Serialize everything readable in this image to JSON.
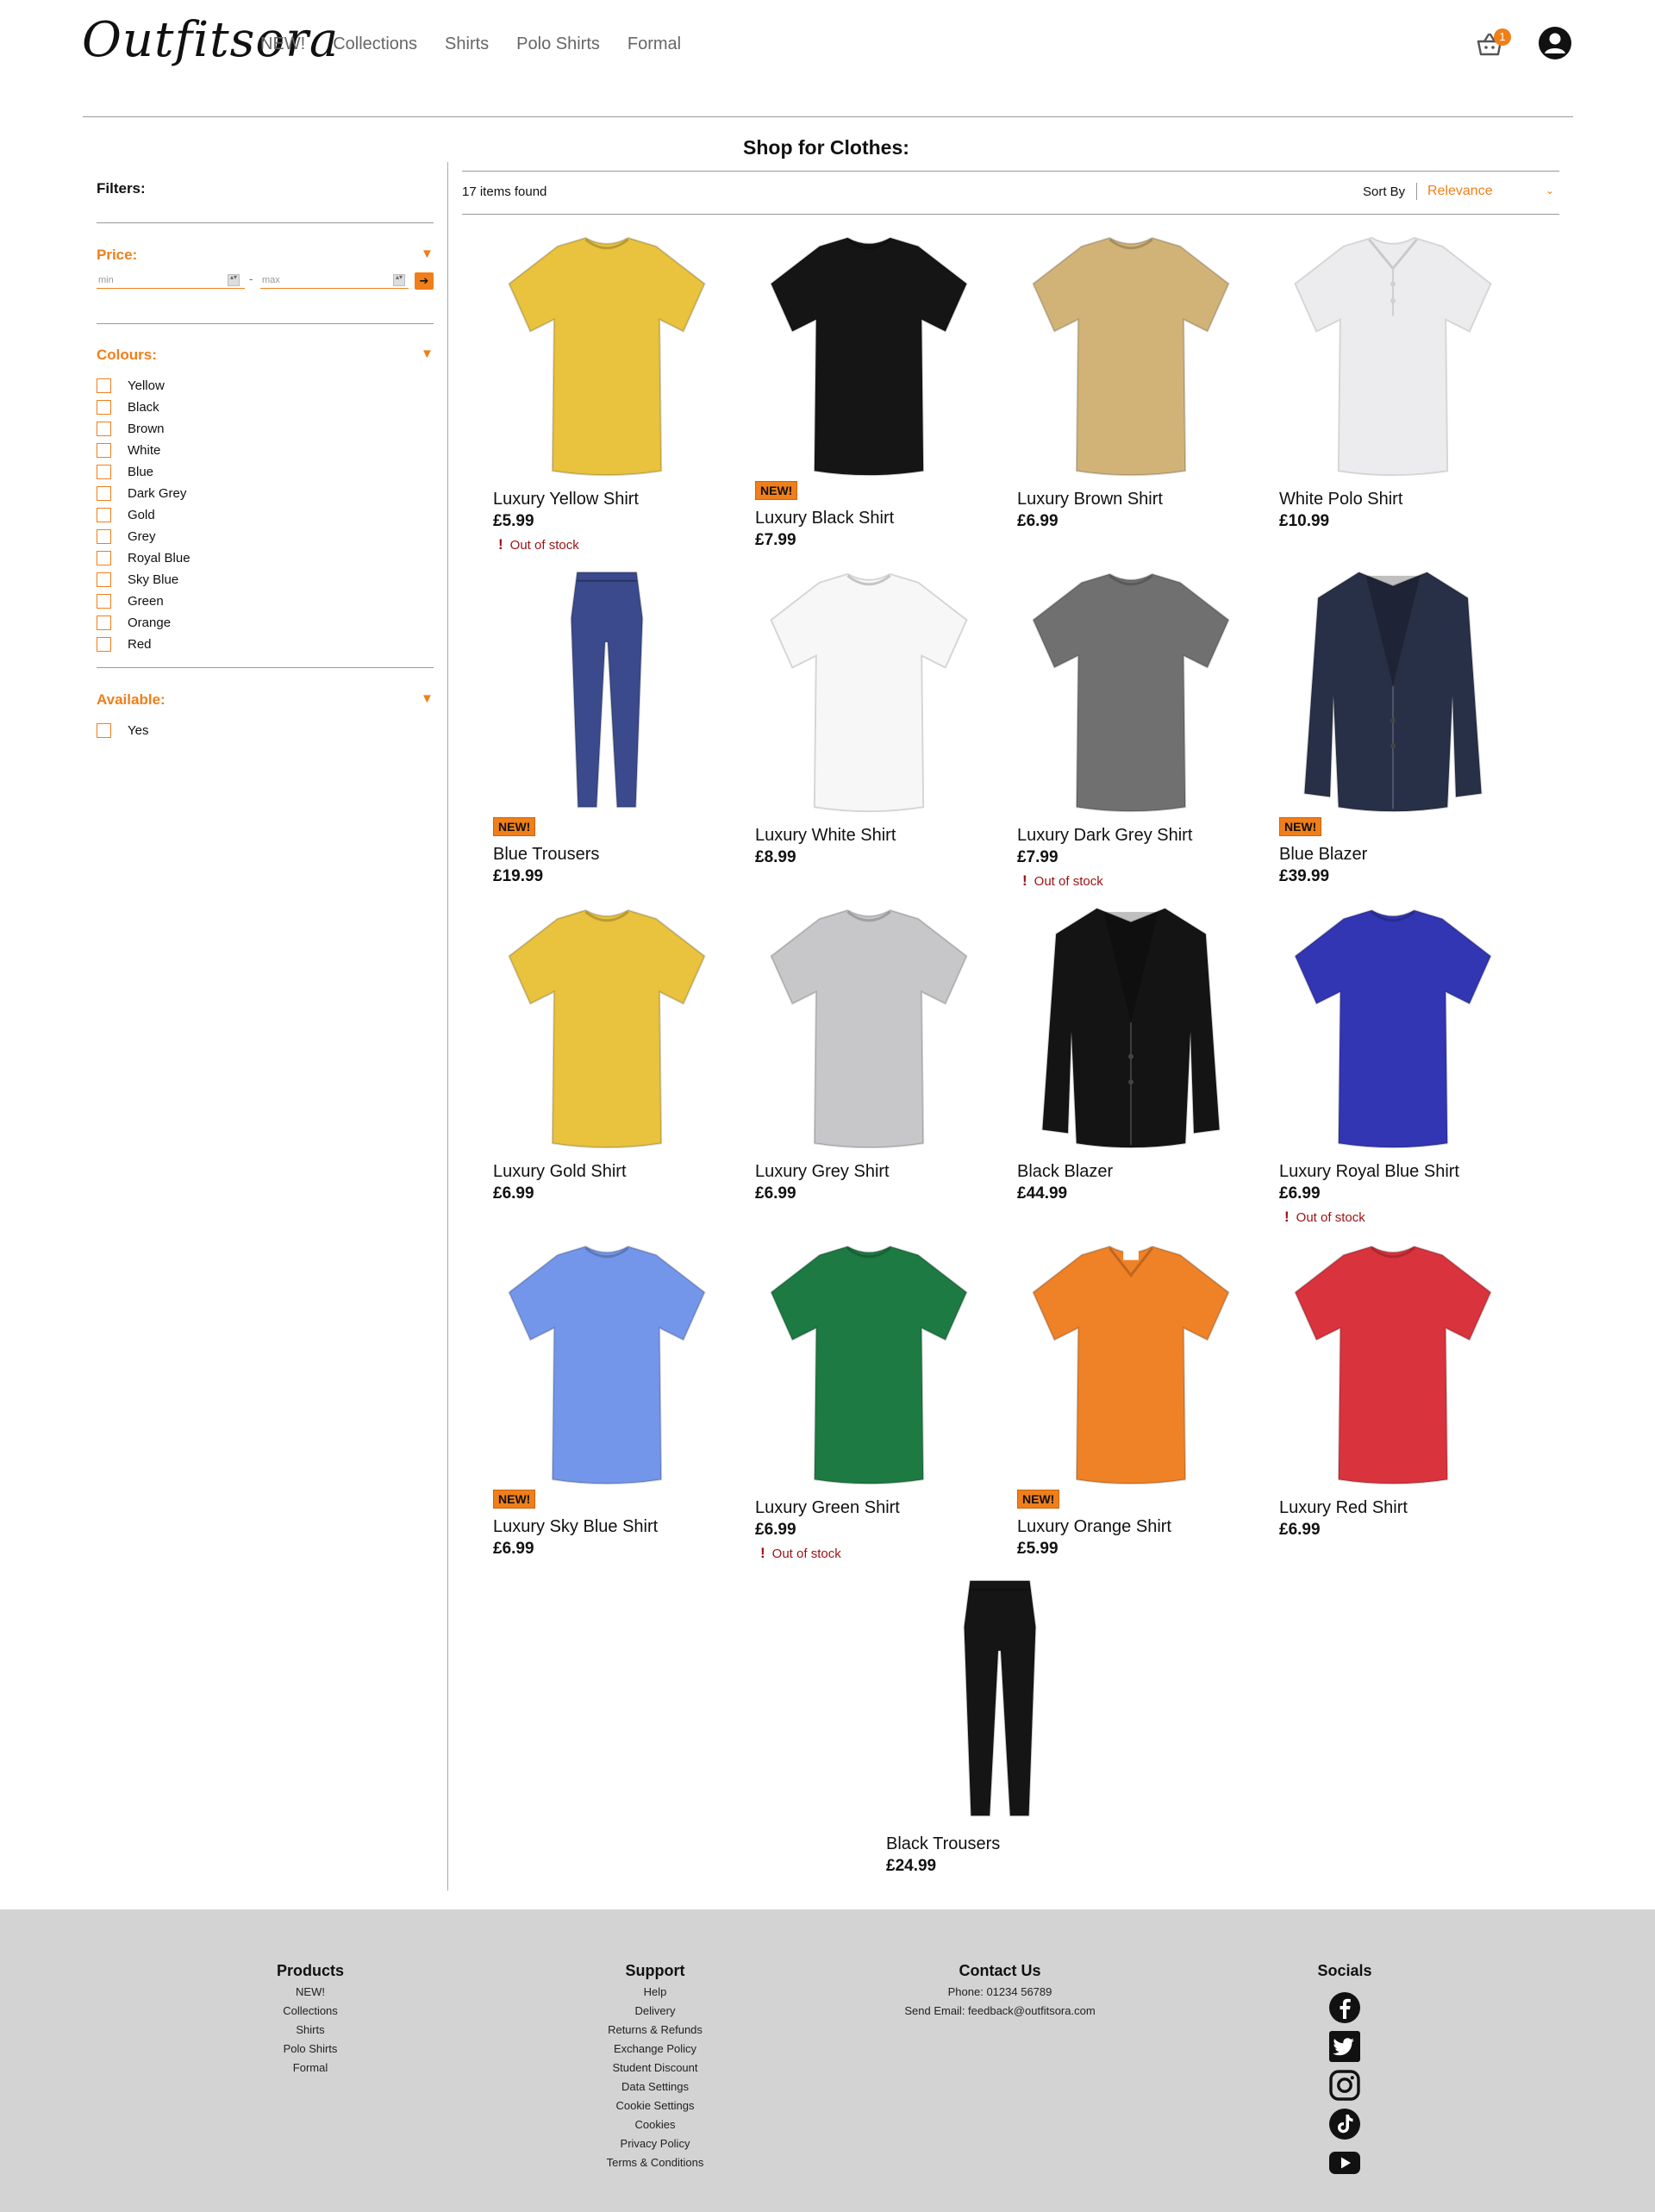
{
  "header": {
    "logo": "Outfitsora",
    "nav": [
      "NEW!",
      "Collections",
      "Shirts",
      "Polo Shirts",
      "Formal"
    ],
    "cart_count": "1"
  },
  "page_title": "Shop for Clothes:",
  "filters": {
    "title": "Filters:",
    "price": {
      "title": "Price:",
      "min_placeholder": "min",
      "max_placeholder": "max",
      "separator": "-",
      "go": "➔"
    },
    "colours": {
      "title": "Colours:",
      "options": [
        "Yellow",
        "Black",
        "Brown",
        "White",
        "Blue",
        "Dark Grey",
        "Gold",
        "Grey",
        "Royal Blue",
        "Sky Blue",
        "Green",
        "Orange",
        "Red"
      ]
    },
    "available": {
      "title": "Available:",
      "options": [
        "Yes"
      ]
    }
  },
  "results": {
    "count_text": "17 items found",
    "sort_label": "Sort By",
    "sort_value": "Relevance"
  },
  "new_badge": "NEW!",
  "out_of_stock": "Out of stock",
  "products": [
    {
      "name": "Luxury Yellow Shirt",
      "price": "£5.99",
      "new": false,
      "out_of_stock": true,
      "kind": "tshirt",
      "color": "#e9c23e"
    },
    {
      "name": "Luxury Black Shirt",
      "price": "£7.99",
      "new": true,
      "out_of_stock": false,
      "kind": "tshirt",
      "color": "#151515"
    },
    {
      "name": "Luxury Brown Shirt",
      "price": "£6.99",
      "new": false,
      "out_of_stock": false,
      "kind": "tshirt",
      "color": "#d2b377"
    },
    {
      "name": "White Polo Shirt",
      "price": "£10.99",
      "new": false,
      "out_of_stock": false,
      "kind": "polo",
      "color": "#ececee"
    },
    {
      "name": "Blue Trousers",
      "price": "£19.99",
      "new": true,
      "out_of_stock": false,
      "kind": "trousers",
      "color": "#3b4a8c"
    },
    {
      "name": "Luxury White Shirt",
      "price": "£8.99",
      "new": false,
      "out_of_stock": false,
      "kind": "tshirt",
      "color": "#f7f7f7"
    },
    {
      "name": "Luxury Dark Grey Shirt",
      "price": "£7.99",
      "new": false,
      "out_of_stock": true,
      "kind": "tshirt",
      "color": "#707070"
    },
    {
      "name": "Blue Blazer",
      "price": "£39.99",
      "new": true,
      "out_of_stock": false,
      "kind": "blazer",
      "color": "#283047"
    },
    {
      "name": "Luxury Gold Shirt",
      "price": "£6.99",
      "new": false,
      "out_of_stock": false,
      "kind": "tshirt",
      "color": "#e9c23e"
    },
    {
      "name": "Luxury Grey Shirt",
      "price": "£6.99",
      "new": false,
      "out_of_stock": false,
      "kind": "tshirt",
      "color": "#c7c7c9"
    },
    {
      "name": "Black Blazer",
      "price": "£44.99",
      "new": false,
      "out_of_stock": false,
      "kind": "blazer",
      "color": "#141414"
    },
    {
      "name": "Luxury Royal Blue Shirt",
      "price": "£6.99",
      "new": false,
      "out_of_stock": true,
      "kind": "tshirt",
      "color": "#3236b3"
    },
    {
      "name": "Luxury Sky Blue Shirt",
      "price": "£6.99",
      "new": true,
      "out_of_stock": false,
      "kind": "tshirt",
      "color": "#7396ea"
    },
    {
      "name": "Luxury Green Shirt",
      "price": "£6.99",
      "new": false,
      "out_of_stock": true,
      "kind": "tshirt",
      "color": "#1d7a42"
    },
    {
      "name": "Luxury Orange Shirt",
      "price": "£5.99",
      "new": true,
      "out_of_stock": false,
      "kind": "vneck",
      "color": "#ef8127"
    },
    {
      "name": "Luxury Red Shirt",
      "price": "£6.99",
      "new": false,
      "out_of_stock": false,
      "kind": "tshirt",
      "color": "#d9333d"
    },
    {
      "name": "Black Trousers",
      "price": "£24.99",
      "new": false,
      "out_of_stock": false,
      "kind": "trousers",
      "color": "#151515"
    }
  ],
  "footer": {
    "products": {
      "title": "Products",
      "links": [
        "NEW!",
        "Collections",
        "Shirts",
        "Polo Shirts",
        "Formal"
      ]
    },
    "support": {
      "title": "Support",
      "links": [
        "Help",
        "Delivery",
        "Returns & Refunds",
        "Exchange Policy",
        "Student Discount",
        "Data Settings",
        "Cookie Settings",
        "Cookies",
        "Privacy Policy",
        "Terms & Conditions"
      ]
    },
    "contact": {
      "title": "Contact Us",
      "lines": [
        "Phone: 01234 56789",
        "Send Email: feedback@outfitsora.com"
      ]
    },
    "socials": {
      "title": "Socials",
      "icons": [
        "facebook-icon",
        "twitter-icon",
        "instagram-icon",
        "tiktok-icon",
        "youtube-icon"
      ]
    }
  },
  "colors": {
    "accent": "#f07f1a",
    "out_of_stock": "#9a1212",
    "footer_bg": "#d3d3d3"
  }
}
